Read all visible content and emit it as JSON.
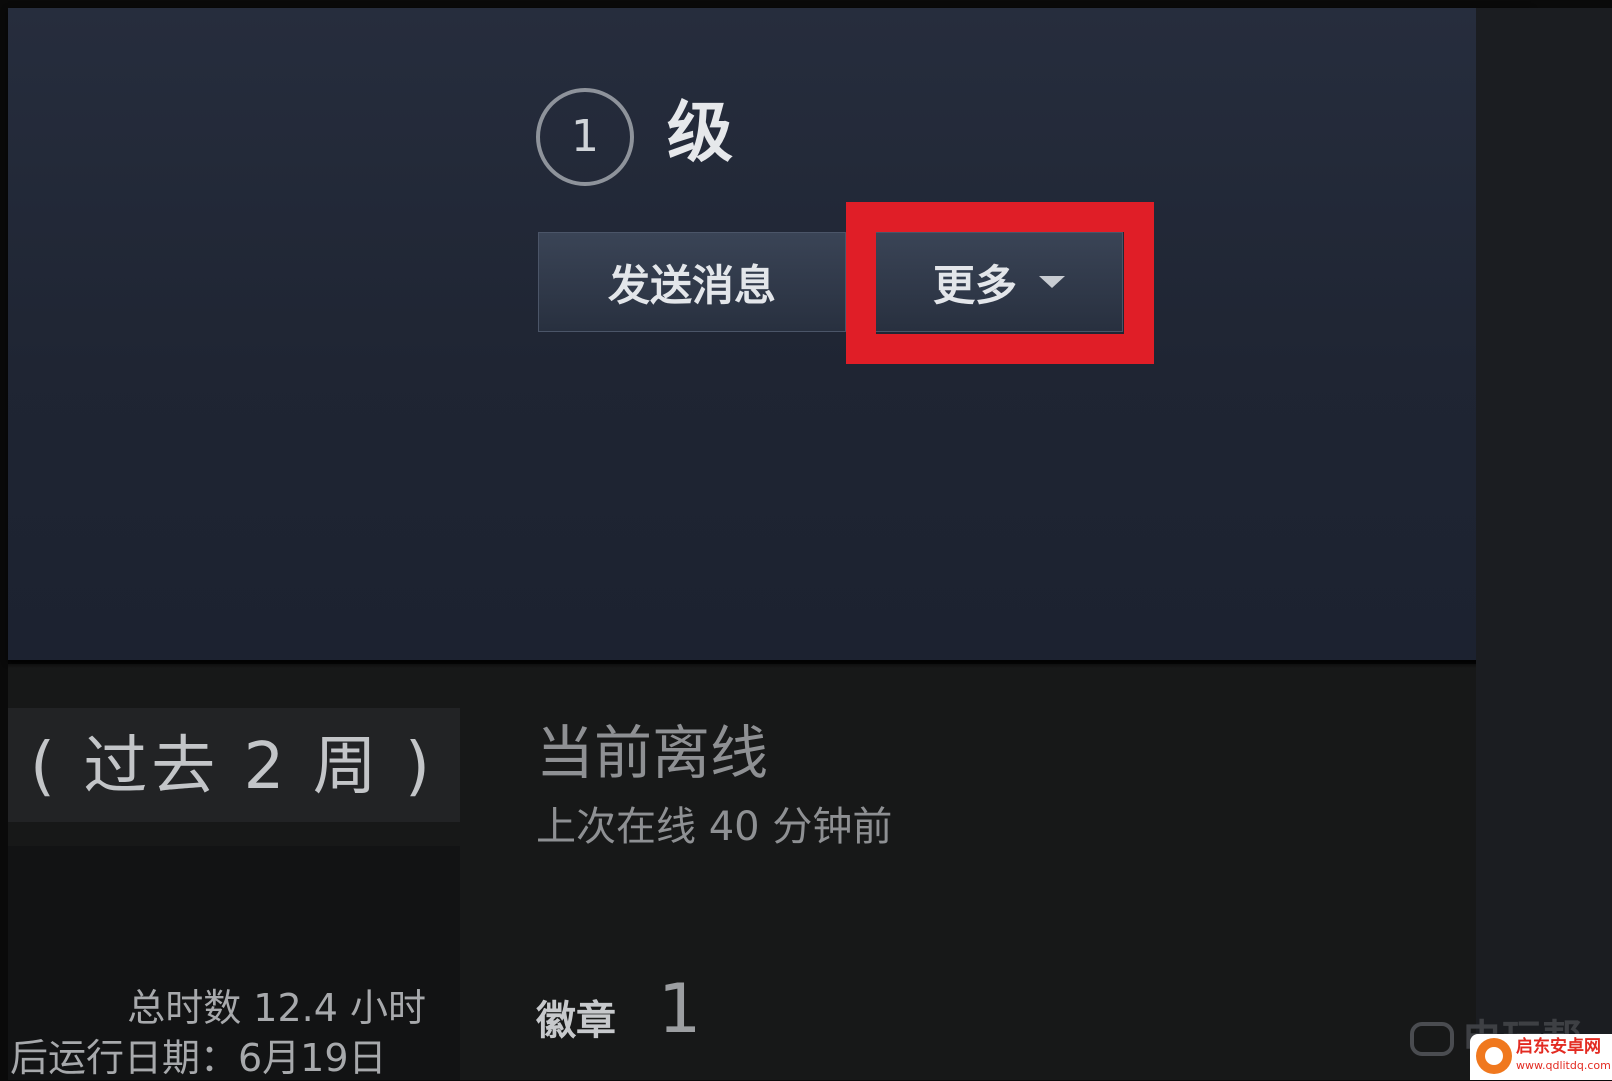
{
  "profile": {
    "level_number": "1",
    "level_label": "级",
    "send_message_label": "发送消息",
    "more_label": "更多"
  },
  "recent_activity": {
    "period_label": "( 过去 2 周 )",
    "total_hours": "总时数 12.4 小时",
    "last_run_date": "后运行日期：6月19日"
  },
  "status": {
    "title": "当前离线",
    "subtitle": "上次在线 40 分钟前"
  },
  "badges": {
    "label": "徽章",
    "count": "1"
  },
  "watermark": {
    "text": "电玩帮",
    "site_name": "启东安卓网",
    "site_url": "www.qdlitdq.com"
  },
  "colors": {
    "highlight": "#e01e27",
    "header_bg": "#1f2533"
  }
}
